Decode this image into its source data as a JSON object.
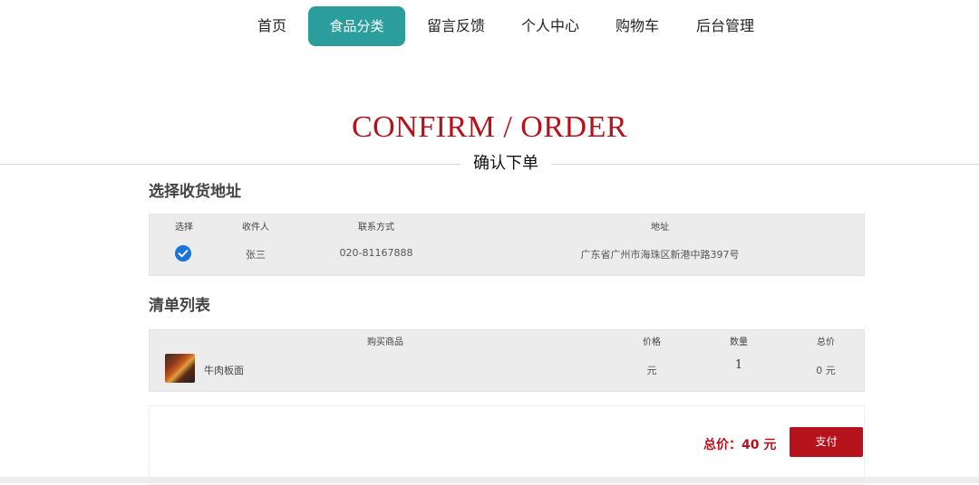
{
  "nav": {
    "items": [
      {
        "label": "首页"
      },
      {
        "label": "食品分类"
      },
      {
        "label": "留言反馈"
      },
      {
        "label": "个人中心"
      },
      {
        "label": "购物车"
      },
      {
        "label": "后台管理"
      }
    ],
    "active_index": 1
  },
  "hero": {
    "title": "CONFIRM / ORDER",
    "subtitle": "确认下单"
  },
  "address_section": {
    "title": "选择收货地址",
    "headers": [
      "选择",
      "收件人",
      "联系方式",
      "地址"
    ],
    "rows": [
      {
        "selected": true,
        "name": "张三",
        "phone": "020-81167888",
        "address": "广东省广州市海珠区新港中路397号"
      }
    ]
  },
  "items_section": {
    "title": "清单列表",
    "headers": [
      "购买商品",
      "价格",
      "数量",
      "总价"
    ],
    "rows": [
      {
        "product": "牛肉板面",
        "price": "元",
        "quantity": "1",
        "subtotal": "0 元"
      }
    ]
  },
  "summary": {
    "total_label": "总价：40 元",
    "pay_label": "支付"
  },
  "colors": {
    "accent": "#2a9d9c",
    "brand_red": "#b5121b",
    "check_blue": "#1b74d8"
  }
}
